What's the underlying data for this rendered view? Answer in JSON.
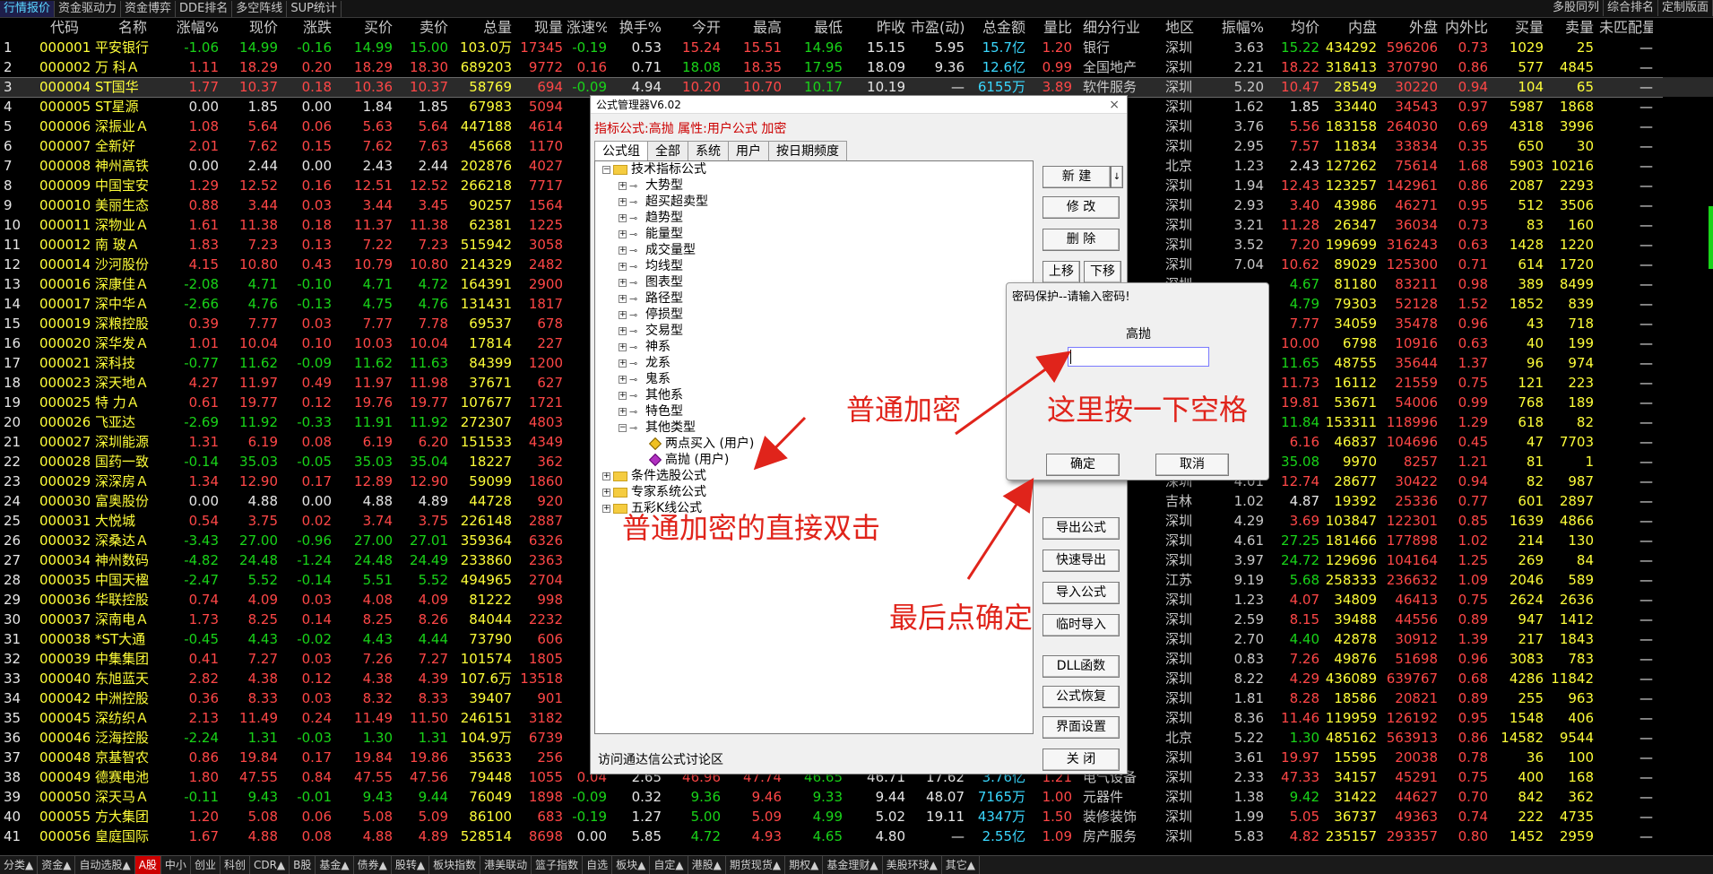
{
  "topbar": {
    "left": [
      "行情报价",
      "资金驱动力",
      "资金博弈",
      "DDE排名",
      "多空阵线",
      "SUP统计"
    ],
    "right": [
      "多股同列",
      "综合排名",
      "定制版面"
    ]
  },
  "columns": [
    "",
    "代码",
    "名称",
    "涨幅%",
    "现价",
    "涨跌",
    "买价",
    "卖价",
    "总量",
    "现量",
    "涨速%",
    "换手%",
    "今开",
    "最高",
    "最低",
    "昨收",
    "市盈(动)",
    "总金额",
    "量比",
    "细分行业",
    "地区",
    "振幅%",
    "均价",
    "内盘",
    "外盘",
    "内外比",
    "买量",
    "卖量",
    "未匹配量"
  ],
  "rows": [
    [
      "1",
      "000001",
      "平安银行",
      "-1.06",
      "14.99",
      "-0.16",
      "14.99",
      "15.00",
      "103.0万",
      "17345",
      "-0.19",
      "0.53",
      "15.24",
      "15.51",
      "14.96",
      "15.15",
      "5.95",
      "15.7亿",
      "1.20",
      "银行",
      "深圳",
      "3.63",
      "15.22",
      "434292",
      "596206",
      "0.73",
      "1029",
      "25",
      "—"
    ],
    [
      "2",
      "000002",
      "万 科Ａ",
      "1.11",
      "18.29",
      "0.20",
      "18.29",
      "18.30",
      "689203",
      "9772",
      "0.16",
      "0.71",
      "18.08",
      "18.35",
      "17.95",
      "18.09",
      "9.36",
      "12.6亿",
      "0.99",
      "全国地产",
      "深圳",
      "2.21",
      "18.22",
      "318413",
      "370790",
      "0.86",
      "577",
      "4845",
      "—"
    ],
    [
      "3",
      "000004",
      "ST国华",
      "1.77",
      "10.37",
      "0.18",
      "10.36",
      "10.37",
      "58769",
      "694",
      "-0.09",
      "4.94",
      "10.20",
      "10.70",
      "10.17",
      "10.19",
      "—",
      "6155万",
      "3.89",
      "软件服务",
      "深圳",
      "5.20",
      "10.47",
      "28549",
      "30220",
      "0.94",
      "104",
      "65",
      "—"
    ],
    [
      "4",
      "000005",
      "ST星源",
      "0.00",
      "1.85",
      "0.00",
      "1.84",
      "1.85",
      "67983",
      "5094",
      "",
      "",
      "",
      "",
      "",
      "",
      "",
      "",
      "",
      "",
      "深圳",
      "1.62",
      "1.85",
      "33440",
      "34543",
      "0.97",
      "5987",
      "1868",
      "—"
    ],
    [
      "5",
      "000006",
      "深振业Ａ",
      "1.08",
      "5.64",
      "0.06",
      "5.63",
      "5.64",
      "447188",
      "4614",
      "",
      "",
      "",
      "",
      "",
      "",
      "",
      "",
      "",
      "",
      "深圳",
      "3.76",
      "5.56",
      "183158",
      "264030",
      "0.69",
      "4318",
      "3996",
      "—"
    ],
    [
      "6",
      "000007",
      "全新好",
      "2.01",
      "7.62",
      "0.15",
      "7.62",
      "7.63",
      "45668",
      "1170",
      "",
      "",
      "",
      "",
      "",
      "",
      "",
      "",
      "",
      "",
      "深圳",
      "2.95",
      "7.57",
      "11834",
      "33834",
      "0.35",
      "650",
      "30",
      "—"
    ],
    [
      "7",
      "000008",
      "神州高铁",
      "0.00",
      "2.44",
      "0.00",
      "2.43",
      "2.44",
      "202876",
      "4027",
      "",
      "",
      "",
      "",
      "",
      "",
      "",
      "",
      "",
      "",
      "北京",
      "1.23",
      "2.43",
      "127262",
      "75614",
      "1.68",
      "5903",
      "10216",
      "—"
    ],
    [
      "8",
      "000009",
      "中国宝安",
      "1.29",
      "12.52",
      "0.16",
      "12.51",
      "12.52",
      "266218",
      "7717",
      "",
      "",
      "",
      "",
      "",
      "",
      "",
      "",
      "",
      "",
      "深圳",
      "1.94",
      "12.43",
      "123257",
      "142961",
      "0.86",
      "2087",
      "2293",
      "—"
    ],
    [
      "9",
      "000010",
      "美丽生态",
      "0.88",
      "3.44",
      "0.03",
      "3.44",
      "3.45",
      "90257",
      "1564",
      "",
      "",
      "",
      "",
      "",
      "",
      "",
      "",
      "",
      "",
      "深圳",
      "2.93",
      "3.40",
      "43986",
      "46271",
      "0.95",
      "512",
      "3506",
      "—"
    ],
    [
      "10",
      "000011",
      "深物业Ａ",
      "1.61",
      "11.38",
      "0.18",
      "11.37",
      "11.38",
      "62381",
      "1225",
      "",
      "",
      "",
      "",
      "",
      "",
      "",
      "",
      "",
      "",
      "深圳",
      "3.21",
      "11.28",
      "26347",
      "36034",
      "0.73",
      "83",
      "160",
      "—"
    ],
    [
      "11",
      "000012",
      "南 玻Ａ",
      "1.83",
      "7.23",
      "0.13",
      "7.22",
      "7.23",
      "515942",
      "3058",
      "",
      "",
      "",
      "",
      "",
      "",
      "",
      "",
      "",
      "",
      "深圳",
      "3.52",
      "7.20",
      "199699",
      "316243",
      "0.63",
      "1428",
      "1220",
      "—"
    ],
    [
      "12",
      "000014",
      "沙河股份",
      "4.15",
      "10.80",
      "0.43",
      "10.79",
      "10.80",
      "214329",
      "2482",
      "",
      "",
      "",
      "",
      "",
      "",
      "",
      "",
      "",
      "",
      "深圳",
      "7.04",
      "10.62",
      "89029",
      "125300",
      "0.71",
      "614",
      "1720",
      "—"
    ],
    [
      "13",
      "000016",
      "深康佳Ａ",
      "-2.08",
      "4.71",
      "-0.10",
      "4.71",
      "4.72",
      "164391",
      "2900",
      "",
      "",
      "",
      "",
      "",
      "",
      "",
      "",
      "",
      "",
      "深圳",
      "",
      "4.67",
      "81180",
      "83211",
      "0.98",
      "389",
      "8499",
      "—"
    ],
    [
      "14",
      "000017",
      "深中华Ａ",
      "-2.66",
      "4.76",
      "-0.13",
      "4.75",
      "4.76",
      "131431",
      "1817",
      "",
      "",
      "",
      "",
      "",
      "",
      "",
      "",
      "",
      "",
      "深圳",
      "",
      "4.79",
      "79303",
      "52128",
      "1.52",
      "1852",
      "839",
      "—"
    ],
    [
      "15",
      "000019",
      "深粮控股",
      "0.39",
      "7.77",
      "0.03",
      "7.77",
      "7.78",
      "69537",
      "678",
      "",
      "",
      "",
      "",
      "",
      "",
      "",
      "",
      "",
      "",
      "深圳",
      "",
      "7.77",
      "34059",
      "35478",
      "0.96",
      "43",
      "718",
      "—"
    ],
    [
      "16",
      "000020",
      "深华发Ａ",
      "1.01",
      "10.04",
      "0.10",
      "10.03",
      "10.04",
      "17814",
      "227",
      "",
      "",
      "",
      "",
      "",
      "",
      "",
      "",
      "",
      "",
      "深圳",
      "",
      "10.00",
      "6798",
      "10916",
      "0.63",
      "40",
      "199",
      "—"
    ],
    [
      "17",
      "000021",
      "深科技",
      "-0.77",
      "11.62",
      "-0.09",
      "11.62",
      "11.63",
      "84399",
      "1200",
      "",
      "",
      "",
      "",
      "",
      "",
      "",
      "",
      "",
      "",
      "深圳",
      "",
      "11.65",
      "48755",
      "35644",
      "1.37",
      "96",
      "974",
      "—"
    ],
    [
      "18",
      "000023",
      "深天地Ａ",
      "4.27",
      "11.97",
      "0.49",
      "11.97",
      "11.98",
      "37671",
      "627",
      "",
      "",
      "",
      "",
      "",
      "",
      "",
      "",
      "",
      "",
      "深圳",
      "",
      "11.73",
      "16112",
      "21559",
      "0.75",
      "121",
      "223",
      "—"
    ],
    [
      "19",
      "000025",
      "特 力Ａ",
      "0.61",
      "19.77",
      "0.12",
      "19.76",
      "19.77",
      "107677",
      "1721",
      "",
      "",
      "",
      "",
      "",
      "",
      "",
      "",
      "",
      "",
      "深圳",
      "",
      "19.81",
      "53671",
      "54006",
      "0.99",
      "768",
      "189",
      "—"
    ],
    [
      "20",
      "000026",
      "飞亚达",
      "-2.69",
      "11.92",
      "-0.33",
      "11.91",
      "11.92",
      "272307",
      "4803",
      "",
      "",
      "",
      "",
      "",
      "",
      "",
      "",
      "",
      "",
      "深圳",
      "",
      "11.84",
      "153311",
      "118996",
      "1.29",
      "618",
      "82",
      "—"
    ],
    [
      "21",
      "000027",
      "深圳能源",
      "1.31",
      "6.19",
      "0.08",
      "6.19",
      "6.20",
      "151533",
      "4349",
      "",
      "",
      "",
      "",
      "",
      "",
      "",
      "",
      "",
      "",
      "深圳",
      "",
      "6.16",
      "46837",
      "104696",
      "0.45",
      "47",
      "7703",
      "—"
    ],
    [
      "22",
      "000028",
      "国药一致",
      "-0.14",
      "35.03",
      "-0.05",
      "35.03",
      "35.04",
      "18227",
      "362",
      "",
      "",
      "",
      "",
      "",
      "",
      "",
      "",
      "",
      "",
      "深圳",
      "",
      "35.08",
      "9970",
      "8257",
      "1.21",
      "81",
      "1",
      "—"
    ],
    [
      "23",
      "000029",
      "深深房Ａ",
      "1.34",
      "12.90",
      "0.17",
      "12.89",
      "12.90",
      "59099",
      "1860",
      "",
      "",
      "",
      "",
      "",
      "",
      "",
      "",
      "",
      "",
      "深圳",
      "4.01",
      "12.74",
      "28677",
      "30422",
      "0.94",
      "82",
      "987",
      "—"
    ],
    [
      "24",
      "000030",
      "富奥股份",
      "0.00",
      "4.88",
      "0.00",
      "4.88",
      "4.89",
      "44728",
      "920",
      "",
      "",
      "",
      "",
      "",
      "",
      "",
      "",
      "",
      "",
      "吉林",
      "1.02",
      "4.87",
      "19392",
      "25336",
      "0.77",
      "601",
      "2897",
      "—"
    ],
    [
      "25",
      "000031",
      "大悦城",
      "0.54",
      "3.75",
      "0.02",
      "3.74",
      "3.75",
      "226148",
      "2887",
      "",
      "",
      "",
      "",
      "",
      "",
      "",
      "",
      "",
      "",
      "深圳",
      "4.29",
      "3.69",
      "103847",
      "122301",
      "0.85",
      "1639",
      "4866",
      "—"
    ],
    [
      "26",
      "000032",
      "深桑达Ａ",
      "-3.43",
      "27.00",
      "-0.96",
      "27.00",
      "27.01",
      "359364",
      "6326",
      "",
      "",
      "",
      "",
      "",
      "",
      "",
      "",
      "",
      "",
      "深圳",
      "4.61",
      "27.25",
      "181466",
      "177898",
      "1.02",
      "214",
      "130",
      "—"
    ],
    [
      "27",
      "000034",
      "神州数码",
      "-4.82",
      "24.48",
      "-1.24",
      "24.48",
      "24.49",
      "233860",
      "2363",
      "",
      "",
      "",
      "",
      "",
      "",
      "",
      "",
      "",
      "",
      "深圳",
      "3.97",
      "24.72",
      "129696",
      "104164",
      "1.25",
      "269",
      "84",
      "—"
    ],
    [
      "28",
      "000035",
      "中国天楹",
      "-2.47",
      "5.52",
      "-0.14",
      "5.51",
      "5.52",
      "494965",
      "2704",
      "",
      "",
      "",
      "",
      "",
      "",
      "",
      "",
      "",
      "",
      "江苏",
      "9.19",
      "5.68",
      "258333",
      "236632",
      "1.09",
      "2046",
      "589",
      "—"
    ],
    [
      "29",
      "000036",
      "华联控股",
      "0.74",
      "4.09",
      "0.03",
      "4.08",
      "4.09",
      "81222",
      "998",
      "",
      "",
      "",
      "",
      "",
      "",
      "",
      "",
      "",
      "",
      "深圳",
      "1.23",
      "4.07",
      "34809",
      "46413",
      "0.75",
      "2624",
      "2636",
      "—"
    ],
    [
      "30",
      "000037",
      "深南电Ａ",
      "1.73",
      "8.25",
      "0.14",
      "8.25",
      "8.26",
      "84044",
      "2232",
      "",
      "",
      "",
      "",
      "",
      "",
      "",
      "",
      "",
      "",
      "深圳",
      "2.59",
      "8.15",
      "39488",
      "44556",
      "0.89",
      "947",
      "1412",
      "—"
    ],
    [
      "31",
      "000038",
      "*ST大通",
      "-0.45",
      "4.43",
      "-0.02",
      "4.43",
      "4.44",
      "73790",
      "606",
      "",
      "",
      "",
      "",
      "",
      "",
      "",
      "",
      "",
      "",
      "深圳",
      "2.70",
      "4.40",
      "42878",
      "30912",
      "1.39",
      "217",
      "1843",
      "—"
    ],
    [
      "32",
      "000039",
      "中集集团",
      "0.41",
      "7.27",
      "0.03",
      "7.26",
      "7.27",
      "101574",
      "1805",
      "",
      "",
      "",
      "",
      "",
      "",
      "",
      "",
      "",
      "",
      "深圳",
      "0.83",
      "7.26",
      "49876",
      "51698",
      "0.96",
      "3083",
      "783",
      "—"
    ],
    [
      "33",
      "000040",
      "东旭蓝天",
      "2.82",
      "4.38",
      "0.12",
      "4.38",
      "4.39",
      "107.6万",
      "13518",
      "",
      "",
      "",
      "",
      "",
      "",
      "",
      "",
      "",
      "",
      "深圳",
      "8.22",
      "4.29",
      "436089",
      "639767",
      "0.68",
      "4286",
      "11842",
      "—"
    ],
    [
      "34",
      "000042",
      "中洲控股",
      "0.36",
      "8.33",
      "0.03",
      "8.32",
      "8.33",
      "39407",
      "901",
      "",
      "",
      "",
      "",
      "",
      "",
      "",
      "",
      "",
      "",
      "深圳",
      "1.81",
      "8.28",
      "18586",
      "20821",
      "0.89",
      "255",
      "963",
      "—"
    ],
    [
      "35",
      "000045",
      "深纺织Ａ",
      "2.13",
      "11.49",
      "0.24",
      "11.49",
      "11.50",
      "246151",
      "3182",
      "",
      "",
      "",
      "",
      "",
      "",
      "",
      "",
      "",
      "",
      "深圳",
      "8.36",
      "11.46",
      "119959",
      "126192",
      "0.95",
      "1548",
      "406",
      "—"
    ],
    [
      "36",
      "000046",
      "泛海控股",
      "-2.24",
      "1.31",
      "-0.03",
      "1.30",
      "1.31",
      "104.9万",
      "6739",
      "",
      "",
      "",
      "",
      "",
      "",
      "",
      "",
      "",
      "",
      "北京",
      "5.22",
      "1.30",
      "485162",
      "563913",
      "0.86",
      "14582",
      "9544",
      "—"
    ],
    [
      "37",
      "000048",
      "京基智农",
      "0.86",
      "19.84",
      "0.17",
      "19.84",
      "19.86",
      "35633",
      "256",
      "",
      "",
      "",
      "",
      "",
      "",
      "",
      "",
      "",
      "",
      "深圳",
      "3.61",
      "19.97",
      "15595",
      "20038",
      "0.78",
      "36",
      "100",
      "—"
    ],
    [
      "38",
      "000049",
      "德赛电池",
      "1.80",
      "47.55",
      "0.84",
      "47.55",
      "47.56",
      "79448",
      "1055",
      "0.04",
      "2.65",
      "46.96",
      "47.74",
      "46.65",
      "46.71",
      "17.62",
      "3.76亿",
      "1.21",
      "电气设备",
      "深圳",
      "2.33",
      "47.33",
      "34157",
      "45291",
      "0.75",
      "400",
      "168",
      "—"
    ],
    [
      "39",
      "000050",
      "深天马Ａ",
      "-0.11",
      "9.43",
      "-0.01",
      "9.43",
      "9.44",
      "76049",
      "1898",
      "-0.09",
      "0.32",
      "9.36",
      "9.46",
      "9.33",
      "9.44",
      "48.07",
      "7165万",
      "1.00",
      "元器件",
      "深圳",
      "1.38",
      "9.42",
      "31422",
      "44627",
      "0.70",
      "842",
      "362",
      "—"
    ],
    [
      "40",
      "000055",
      "方大集团",
      "1.20",
      "5.08",
      "0.06",
      "5.08",
      "5.09",
      "86100",
      "683",
      "-0.19",
      "1.27",
      "5.00",
      "5.09",
      "4.99",
      "5.02",
      "19.11",
      "4347万",
      "1.50",
      "装修装饰",
      "深圳",
      "1.99",
      "5.05",
      "36737",
      "49363",
      "0.74",
      "222",
      "4735",
      "—"
    ],
    [
      "41",
      "000056",
      "皇庭国际",
      "1.67",
      "4.88",
      "0.08",
      "4.88",
      "4.89",
      "528514",
      "8698",
      "0.00",
      "5.85",
      "4.72",
      "4.93",
      "4.65",
      "4.80",
      "—",
      "2.55亿",
      "1.09",
      "房产服务",
      "深圳",
      "5.83",
      "4.82",
      "235157",
      "293357",
      "0.80",
      "1452",
      "2959",
      "—"
    ]
  ],
  "bottombar": [
    "分类▲",
    "资金▲",
    "自动选股▲",
    "A股",
    "中小",
    "创业",
    "科创",
    "CDR▲",
    "B股",
    "基金▲",
    "债券▲",
    "股转▲",
    "板块指数",
    "港美联动",
    "篮子指数",
    "自选",
    "板块▲",
    "自定▲",
    "港股▲",
    "期货现货▲",
    "期权▲",
    "基金理财▲",
    "美股环球▲",
    "其它▲"
  ],
  "formula_manager": {
    "title": "公式管理器V6.02",
    "close": "×",
    "info": "指标公式:高抛  属性:用户公式  加密",
    "tabs": [
      "公式组",
      "全部",
      "系统",
      "用户",
      "按日期频度"
    ],
    "tree": {
      "root": "技术指标公式",
      "groups": [
        "大势型",
        "超买超卖型",
        "趋势型",
        "能量型",
        "成交量型",
        "均线型",
        "图表型",
        "路径型",
        "停损型",
        "交易型",
        "神系",
        "龙系",
        "鬼系",
        "其他系",
        "特色型"
      ],
      "other": "其他类型",
      "items": [
        "两点买入  (用户)",
        "高抛  (用户)"
      ],
      "tail": [
        "条件选股公式",
        "专家系统公式",
        "五彩K线公式"
      ]
    },
    "buttons": {
      "new": "新  建",
      "modify": "修  改",
      "delete": "删  除",
      "up": "上移",
      "down": "下移",
      "export": "导出公式",
      "quick_export": "快速导出",
      "import": "导入公式",
      "temp_import": "临时导入",
      "dll": "DLL函数",
      "restore": "公式恢复",
      "ui_settings": "界面设置",
      "close": "关  闭"
    },
    "status": "访问通达信公式讨论区"
  },
  "password_dialog": {
    "title": "密码保护--请输入密码!",
    "label": "高抛",
    "ok": "确定",
    "cancel": "取消"
  },
  "annotations": {
    "a1": "普通加密",
    "a2": "这里按一下空格",
    "a3": "普通加密的直接双击",
    "a4": "最后点确定"
  }
}
